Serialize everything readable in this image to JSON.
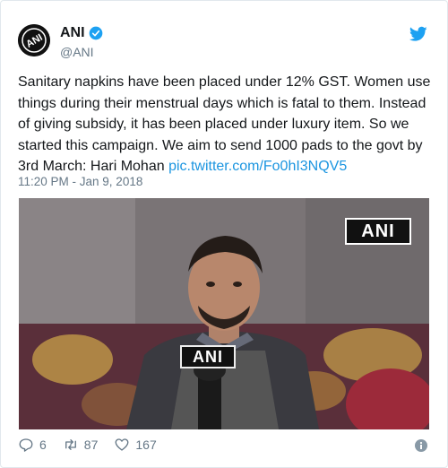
{
  "tweet": {
    "author_name": "ANI",
    "handle": "@ANI",
    "text_before_link": "Sanitary napkins have been placed under 12% GST. Women use things during their menstrual days which is fatal to them. Instead of giving subsidy, it has been placed under luxury item. So we started this campaign. We aim to send 1000 pads to the govt by 3rd March: Hari Mohan ",
    "link_text": "pic.twitter.com/Fo0hI3NQV5",
    "timestamp": "11:20 PM - Jan 9, 2018",
    "media": {
      "watermark": "ANI",
      "mic_label": "ANI"
    },
    "actions": {
      "replies": "6",
      "retweets": "87",
      "likes": "167"
    },
    "avatar_text": "ANI"
  },
  "colors": {
    "link": "#1b95e0",
    "verified": "#1da1f2",
    "twitter_brand": "#1da1f2",
    "muted": "#657786"
  },
  "icons": [
    "verified-badge-icon",
    "twitter-bird-icon",
    "reply-icon",
    "retweet-icon",
    "like-icon",
    "info-icon"
  ]
}
